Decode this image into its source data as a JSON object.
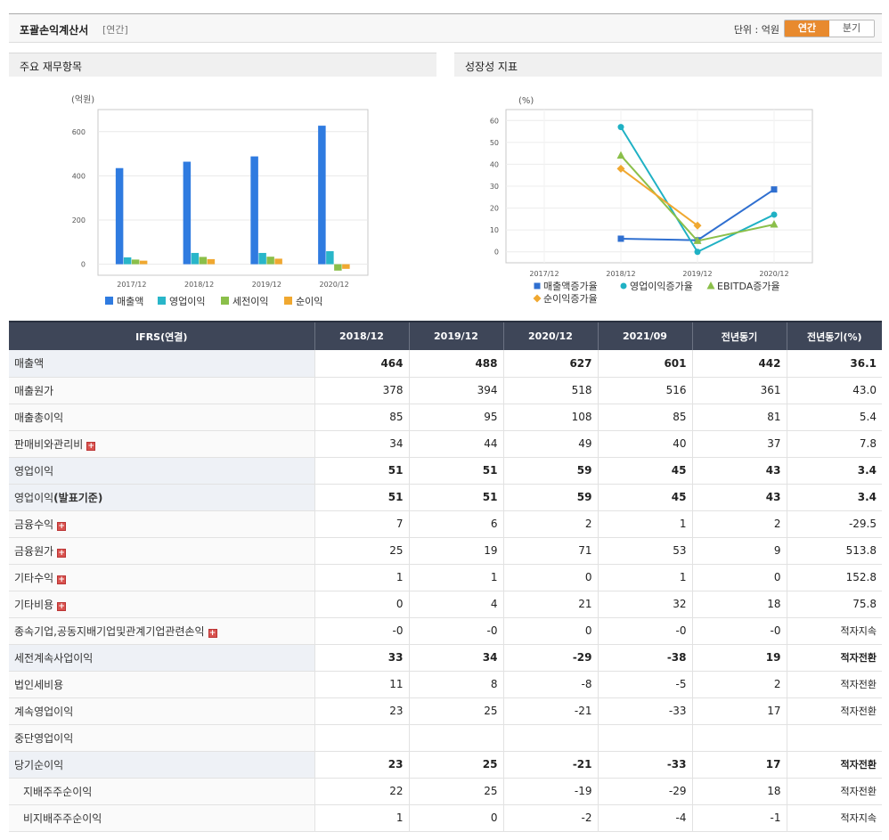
{
  "header": {
    "title": "포괄손익계산서",
    "period": "[연간]",
    "unit": "단위 : 억원",
    "tabs": [
      "연간",
      "분기"
    ]
  },
  "left_panel": {
    "title": "주요 재무항목"
  },
  "right_panel": {
    "title": "성장성 지표"
  },
  "chart_data": [
    {
      "type": "bar",
      "ylabel": "(억원)",
      "categories": [
        "2017/12",
        "2018/12",
        "2019/12",
        "2020/12"
      ],
      "yticks": [
        0,
        200,
        400,
        600
      ],
      "ylim": [
        -50,
        700
      ],
      "series": [
        {
          "name": "매출액",
          "color": "#2f7be0",
          "values": [
            435,
            464,
            488,
            627
          ]
        },
        {
          "name": "영업이익",
          "color": "#29b6c9",
          "values": [
            31,
            51,
            51,
            59
          ]
        },
        {
          "name": "세전이익",
          "color": "#8bbf4a",
          "values": [
            21,
            33,
            34,
            -29
          ]
        },
        {
          "name": "순이익",
          "color": "#f0a830",
          "values": [
            16,
            23,
            25,
            -21
          ]
        }
      ],
      "legend": "bottom"
    },
    {
      "type": "line",
      "ylabel": "(%)",
      "categories": [
        "2017/12",
        "2018/12",
        "2019/12",
        "2020/12"
      ],
      "yticks": [
        0,
        10,
        20,
        30,
        40,
        50,
        60
      ],
      "ylim": [
        -5,
        65
      ],
      "series": [
        {
          "name": "매출액증가율",
          "color": "#2f6fd0",
          "marker": "square",
          "values": [
            null,
            6,
            5.3,
            28.5
          ]
        },
        {
          "name": "영업이익증가율",
          "color": "#1fb1c4",
          "marker": "circle",
          "values": [
            null,
            57,
            0,
            17
          ]
        },
        {
          "name": "EBITDA증가율",
          "color": "#8bbf4a",
          "marker": "triangle",
          "values": [
            null,
            44,
            5,
            12.5
          ]
        },
        {
          "name": "순이익증가율",
          "color": "#f0a830",
          "marker": "diamond",
          "values": [
            null,
            38,
            12,
            null
          ]
        }
      ],
      "legend": "bottom"
    }
  ],
  "table": {
    "headers": [
      "IFRS(연결)",
      "2018/12",
      "2019/12",
      "2020/12",
      "2021/09",
      "전년동기",
      "전년동기(%)"
    ],
    "rows": [
      {
        "label": "매출액",
        "values": [
          "464",
          "488",
          "627",
          "601",
          "442",
          "36.1"
        ],
        "bold": true
      },
      {
        "label": "매출원가",
        "values": [
          "378",
          "394",
          "518",
          "516",
          "361",
          "43.0"
        ]
      },
      {
        "label": "매출총이익",
        "values": [
          "85",
          "95",
          "108",
          "85",
          "81",
          "5.4"
        ]
      },
      {
        "label": "판매비와관리비",
        "values": [
          "34",
          "44",
          "49",
          "40",
          "37",
          "7.8"
        ],
        "expand": true
      },
      {
        "label": "영업이익",
        "values": [
          "51",
          "51",
          "59",
          "45",
          "43",
          "3.4"
        ],
        "bold": true
      },
      {
        "label": "영업이익(발표기준)",
        "values": [
          "51",
          "51",
          "59",
          "45",
          "43",
          "3.4"
        ],
        "bold": true,
        "labelBoldPart": true
      },
      {
        "label": "금융수익",
        "values": [
          "7",
          "6",
          "2",
          "1",
          "2",
          "-29.5"
        ],
        "expand": true
      },
      {
        "label": "금융원가",
        "values": [
          "25",
          "19",
          "71",
          "53",
          "9",
          "513.8"
        ],
        "expand": true
      },
      {
        "label": "기타수익",
        "values": [
          "1",
          "1",
          "0",
          "1",
          "0",
          "152.8"
        ],
        "expand": true
      },
      {
        "label": "기타비용",
        "values": [
          "0",
          "4",
          "21",
          "32",
          "18",
          "75.8"
        ],
        "expand": true
      },
      {
        "label": "종속기업,공동지배기업및관계기업관련손익",
        "values": [
          "-0",
          "-0",
          "0",
          "-0",
          "-0",
          "적자지속"
        ],
        "expand": true
      },
      {
        "label": "세전계속사업이익",
        "values": [
          "33",
          "34",
          "-29",
          "-38",
          "19",
          "적자전환"
        ],
        "bold": true
      },
      {
        "label": "법인세비용",
        "values": [
          "11",
          "8",
          "-8",
          "-5",
          "2",
          "적자전환"
        ]
      },
      {
        "label": "계속영업이익",
        "values": [
          "23",
          "25",
          "-21",
          "-33",
          "17",
          "적자전환"
        ]
      },
      {
        "label": "중단영업이익",
        "values": [
          "",
          "",
          "",
          "",
          "",
          ""
        ]
      },
      {
        "label": "당기순이익",
        "values": [
          "23",
          "25",
          "-21",
          "-33",
          "17",
          "적자전환"
        ],
        "bold": true
      },
      {
        "label": "지배주주순이익",
        "values": [
          "22",
          "25",
          "-19",
          "-29",
          "18",
          "적자전환"
        ],
        "sub": true
      },
      {
        "label": "비지배주주순이익",
        "values": [
          "1",
          "0",
          "-2",
          "-4",
          "-1",
          "적자지속"
        ],
        "sub": true
      }
    ]
  }
}
